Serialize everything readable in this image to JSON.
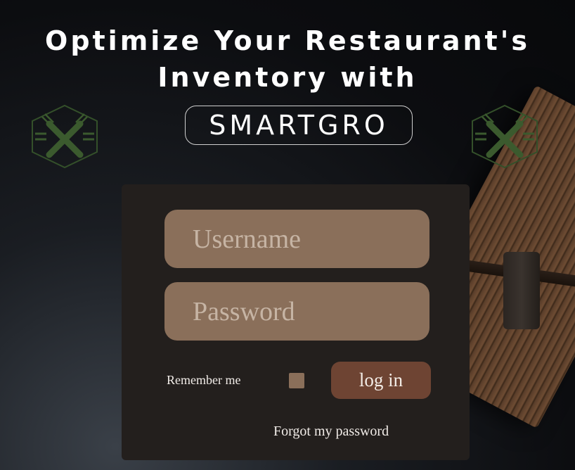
{
  "hero": {
    "line1": "Optimize Your Restaurant's",
    "line2": "Inventory with",
    "brand": "SMARTGRO"
  },
  "login_form": {
    "username_placeholder": "Username",
    "password_placeholder": "Password",
    "remember_label": "Remember me",
    "login_label": "log in",
    "forgot_link": "Forgot my password"
  },
  "colors": {
    "background": "#0c0d10",
    "card": "#231f1d",
    "field": "#8a6f5a",
    "button": "#6e4433",
    "logo_green": "#3b5a2e"
  },
  "icons": {
    "logo": "crossed-fork-knife-hexagon-icon"
  }
}
